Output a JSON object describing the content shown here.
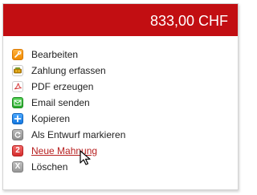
{
  "header": {
    "amount": "833,00 CHF",
    "background_color": "#c20e12"
  },
  "menu": {
    "items": [
      {
        "label": "Bearbeiten",
        "icon": "edit-icon"
      },
      {
        "label": "Zahlung erfassen",
        "icon": "payment-icon"
      },
      {
        "label": "PDF erzeugen",
        "icon": "pdf-icon"
      },
      {
        "label": "Email senden",
        "icon": "email-icon"
      },
      {
        "label": "Kopieren",
        "icon": "copy-icon"
      },
      {
        "label": "Als Entwurf markieren",
        "icon": "draft-icon"
      },
      {
        "label": "Neue Mahnung",
        "icon": "reminder-icon",
        "icon_text": "2",
        "state": "hover"
      },
      {
        "label": "Löschen",
        "icon": "delete-icon",
        "icon_text": "X"
      }
    ]
  },
  "colors": {
    "link_hover": "#b71f1f",
    "text": "#222222"
  }
}
